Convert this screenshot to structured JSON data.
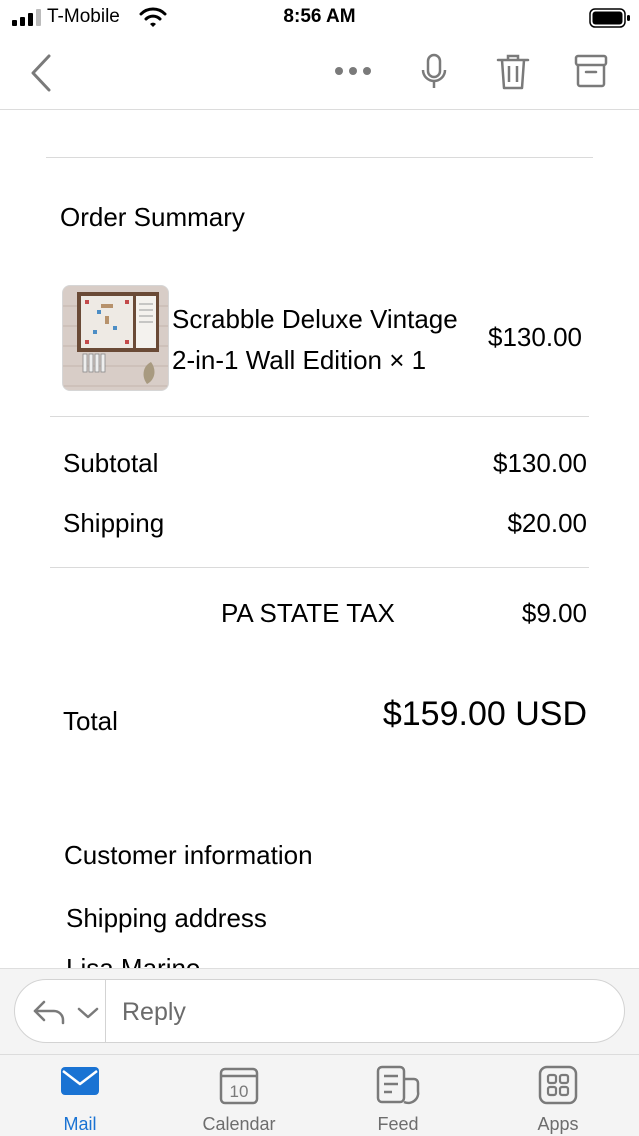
{
  "status_bar": {
    "carrier": "T-Mobile",
    "time": "8:56 AM"
  },
  "toolbar": {
    "icons": [
      "back-chevron-icon",
      "more-icon",
      "microphone-icon",
      "trash-icon",
      "archive-icon"
    ]
  },
  "order": {
    "title": "Order Summary",
    "item": {
      "name": "Scrabble Deluxe Vintage 2-in-1 Wall Edition × 1",
      "price": "$130.00"
    },
    "subtotal_label": "Subtotal",
    "subtotal_value": "$130.00",
    "shipping_label": "Shipping",
    "shipping_value": "$20.00",
    "tax_label": "PA STATE TAX",
    "tax_value": "$9.00",
    "total_label": "Total",
    "total_value": "$159.00 USD"
  },
  "customer": {
    "title": "Customer information",
    "shipping_address_title": "Shipping address",
    "name_partial": "Lisa Marino"
  },
  "reply": {
    "placeholder": "Reply"
  },
  "tabs": [
    {
      "label": "Mail",
      "icon": "mail-icon",
      "active": true
    },
    {
      "label": "Calendar",
      "icon": "calendar-icon",
      "badge": "10"
    },
    {
      "label": "Feed",
      "icon": "feed-icon"
    },
    {
      "label": "Apps",
      "icon": "apps-icon"
    }
  ],
  "colors": {
    "accent": "#1a73d3",
    "icon_gray": "#7a7a7a"
  }
}
